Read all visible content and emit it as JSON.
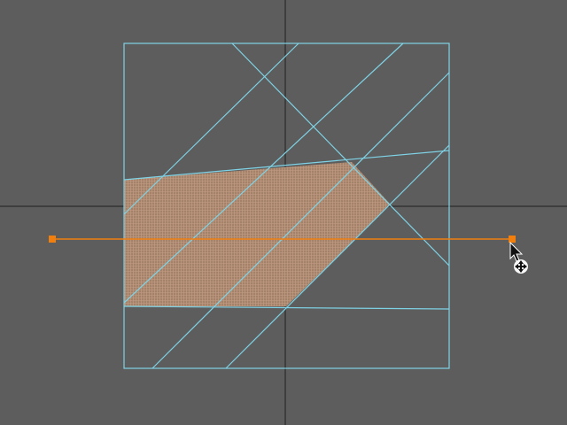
{
  "viewport": {
    "background": "#5d5d5d",
    "axis_color": "#3e3e3e",
    "wire_color": "#7fd3e6",
    "cut_line_color": "#f07f0e",
    "selection_fill": "#a4826a",
    "selection_mesh": "#bf9a80"
  },
  "tool": {
    "name": "multi-cut",
    "cursor_icon": "arrow-pointer-icon",
    "move_icon": "move-cross-icon"
  }
}
